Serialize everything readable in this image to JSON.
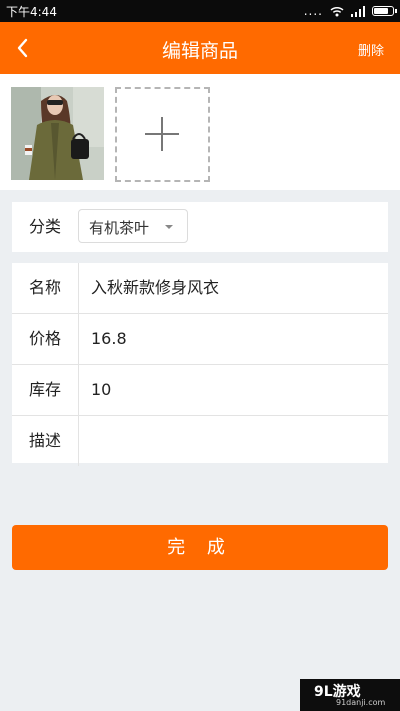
{
  "status_bar": {
    "time": "下午4:44",
    "signal": "....",
    "battery_level": 0.85
  },
  "header": {
    "title": "编辑商品",
    "delete_label": "删除"
  },
  "images": {
    "photo_alt": "商品图片"
  },
  "category": {
    "label": "分类",
    "selected": "有机茶叶"
  },
  "fields": [
    {
      "label": "名称",
      "value": "入秋新款修身风衣"
    },
    {
      "label": "价格",
      "value": "16.8"
    },
    {
      "label": "库存",
      "value": "10"
    },
    {
      "label": "描述",
      "value": ""
    }
  ],
  "actions": {
    "done_label": "完 成"
  },
  "watermark": {
    "brand": "9L游戏",
    "url": "91danji.com"
  }
}
